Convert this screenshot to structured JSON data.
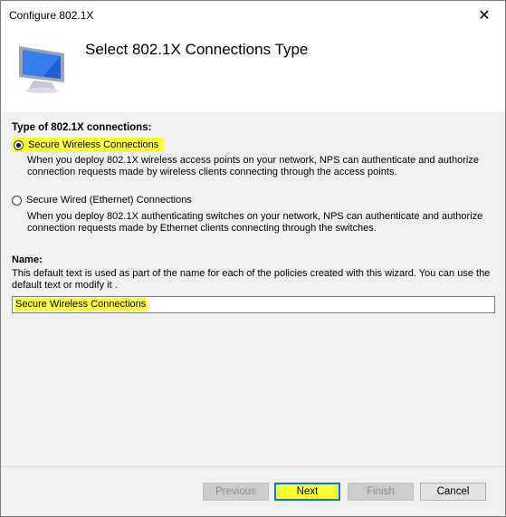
{
  "window": {
    "title": "Configure 802.1X",
    "close_glyph": "✕"
  },
  "header": {
    "title": "Select 802.1X Connections Type",
    "icon": "monitor-computer-icon"
  },
  "connections": {
    "heading": "Type of 802.1X connections:",
    "options": [
      {
        "label": "Secure Wireless Connections",
        "checked": true,
        "description": "When you deploy 802.1X wireless access points on your network, NPS can authenticate and authorize connection requests made by wireless clients connecting through the access points."
      },
      {
        "label": "Secure Wired (Ethernet) Connections",
        "checked": false,
        "description": "When you deploy 802.1X authenticating switches on your network, NPS can authenticate and authorize connection requests made by Ethernet clients connecting through the switches."
      }
    ]
  },
  "name": {
    "label": "Name:",
    "description": "This default text is used as part of the name for each of the policies created with this wizard. You can use the default text or modify it .",
    "value": "Secure Wireless Connections"
  },
  "buttons": {
    "previous": "Previous",
    "next": "Next",
    "finish": "Finish",
    "cancel": "Cancel"
  },
  "colors": {
    "highlight": "#ffff33",
    "focus_border": "#0078d7"
  }
}
